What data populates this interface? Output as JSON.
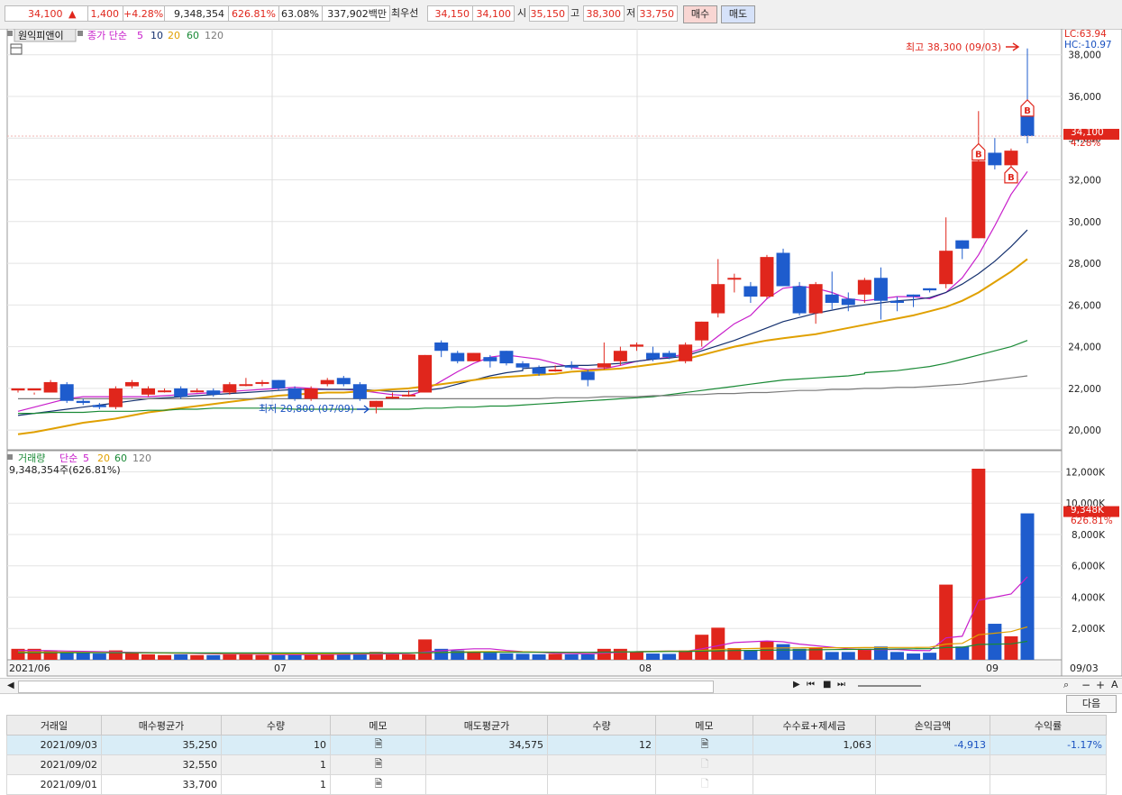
{
  "quote": {
    "price": "34,100",
    "arrow": "▲",
    "change": "1,400",
    "change_pct": "+4.28%",
    "volume": "9,348,354",
    "vol_ratio": "626.81%",
    "vol_turn": "63.08%",
    "amount": "337,902백만",
    "best_label": "최우선",
    "best_ask": "34,150",
    "best_bid": "34,100",
    "open_label": "시",
    "open": "35,150",
    "high_label": "고",
    "high": "38,300",
    "low_label": "저",
    "low": "33,750",
    "buy_label": "매수",
    "sell_label": "매도"
  },
  "chart_header": {
    "stock_name": "원익피앤이",
    "price_legend": "종가 단순",
    "ma_labels": [
      "5",
      "10",
      "20",
      "60",
      "120"
    ],
    "ma_colors": [
      "#c81ecb",
      "#14306e",
      "#e0a000",
      "#1a8a36",
      "#7a7a7a"
    ],
    "lc": "LC:63.94",
    "hc": "HC:-10.97",
    "vol_legend_label": "거래량",
    "vol_legend_type": "단순",
    "vol_ma_labels": [
      "5",
      "20",
      "60",
      "120"
    ],
    "vol_summary": "9,348,354주(626.81%)"
  },
  "annotations": {
    "max_label": "최고 38,300 (09/03)",
    "min_label": "최저 20,800 (07/09)",
    "last_price_tag": "34,100",
    "last_pct_tag": "4.28%",
    "last_vol_tag": "9,348K",
    "last_vol_pct_tag": "626.81%",
    "trade_marker": "B"
  },
  "chart_data": {
    "type": "candlestick",
    "x_labels": [
      "2021/06",
      "07",
      "08",
      "09",
      "09/03"
    ],
    "price_axis_ticks": [
      "20,000",
      "22,000",
      "24,000",
      "26,000",
      "28,000",
      "30,000",
      "32,000",
      "34,000",
      "36,000",
      "38,000"
    ],
    "price_ylim": [
      19000,
      39000
    ],
    "volume_axis_ticks": [
      "2,000K",
      "4,000K",
      "6,000K",
      "8,000K",
      "10,000K",
      "12,000K"
    ],
    "volume_ylim": [
      0,
      12500
    ],
    "candles": [
      [
        21900,
        22000,
        21800,
        21900
      ],
      [
        21900,
        22000,
        21800,
        21700
      ],
      [
        21800,
        22300,
        22400,
        22000
      ],
      [
        22200,
        21400,
        22300,
        21300
      ],
      [
        21400,
        21300,
        21500,
        21200
      ],
      [
        21200,
        21100,
        21300,
        21000
      ],
      [
        21100,
        22000,
        22100,
        21000
      ],
      [
        22100,
        22300,
        22400,
        22000
      ],
      [
        21700,
        22000,
        22100,
        21600
      ],
      [
        21900,
        21900,
        22000,
        21800
      ],
      [
        22000,
        21600,
        22100,
        21500
      ],
      [
        21900,
        21900,
        22000,
        21800
      ],
      [
        21900,
        21700,
        22000,
        21600
      ],
      [
        21800,
        22200,
        22300,
        21700
      ],
      [
        22200,
        22200,
        22500,
        22100
      ],
      [
        22300,
        22300,
        22400,
        22100
      ],
      [
        22400,
        22000,
        22400,
        21900
      ],
      [
        22000,
        21500,
        22100,
        21400
      ],
      [
        21500,
        22000,
        22100,
        21400
      ],
      [
        22200,
        22400,
        22500,
        22100
      ],
      [
        22500,
        22200,
        22600,
        22100
      ],
      [
        22200,
        21500,
        22300,
        21400
      ],
      [
        21100,
        21400,
        21400,
        20800
      ],
      [
        21600,
        21600,
        21800,
        21500
      ],
      [
        21700,
        21700,
        21900,
        21600
      ],
      [
        21800,
        23600,
        23600,
        21800
      ],
      [
        24200,
        23800,
        24300,
        23500
      ],
      [
        23700,
        23300,
        23800,
        23200
      ],
      [
        23300,
        23700,
        23700,
        23300
      ],
      [
        23500,
        23300,
        23600,
        23000
      ],
      [
        23800,
        23200,
        23800,
        23100
      ],
      [
        23200,
        23000,
        23300,
        22900
      ],
      [
        23000,
        22700,
        23100,
        22600
      ],
      [
        22900,
        22900,
        23100,
        22800
      ],
      [
        23100,
        23000,
        23300,
        22900
      ],
      [
        22800,
        22400,
        22900,
        22100
      ],
      [
        23000,
        23200,
        24200,
        22900
      ],
      [
        23300,
        23800,
        24000,
        23100
      ],
      [
        24000,
        24100,
        24200,
        23800
      ],
      [
        23700,
        23400,
        24000,
        23300
      ],
      [
        23700,
        23500,
        23800,
        23400
      ],
      [
        23300,
        24100,
        24200,
        23200
      ],
      [
        24300,
        25200,
        25200,
        24000
      ],
      [
        25600,
        27000,
        28200,
        25400
      ],
      [
        27300,
        27300,
        27500,
        26600
      ],
      [
        26900,
        26400,
        27100,
        26100
      ],
      [
        26400,
        28300,
        28400,
        26300
      ],
      [
        28500,
        26900,
        28700,
        26900
      ],
      [
        26900,
        25600,
        27100,
        25500
      ],
      [
        25600,
        27000,
        27100,
        25100
      ],
      [
        26500,
        26100,
        27600,
        25800
      ],
      [
        26300,
        26000,
        26600,
        25700
      ],
      [
        26500,
        27200,
        27300,
        26100
      ],
      [
        27300,
        26200,
        27800,
        25300
      ],
      [
        26200,
        26100,
        26400,
        25700
      ],
      [
        26500,
        26400,
        26500,
        25900
      ],
      [
        26800,
        26700,
        26800,
        26600
      ],
      [
        27000,
        28600,
        30200,
        26800
      ],
      [
        29100,
        28700,
        29100,
        28200
      ],
      [
        29200,
        32900,
        35300,
        29200
      ],
      [
        33300,
        32700,
        34000,
        32500
      ],
      [
        32700,
        33400,
        33500,
        32300
      ],
      [
        35150,
        34100,
        38300,
        33750
      ]
    ],
    "volumes": [
      700,
      700,
      600,
      500,
      450,
      400,
      600,
      450,
      350,
      300,
      350,
      300,
      300,
      400,
      350,
      300,
      300,
      350,
      350,
      400,
      350,
      400,
      500,
      350,
      350,
      1300,
      700,
      600,
      500,
      450,
      400,
      380,
      350,
      380,
      350,
      350,
      700,
      700,
      500,
      400,
      380,
      600,
      1600,
      2050,
      750,
      600,
      1200,
      1000,
      700,
      750,
      500,
      500,
      700,
      850,
      500,
      400,
      450,
      4800,
      850,
      12200,
      2300,
      1500,
      9348
    ],
    "moving_averages": [
      {
        "name": "5",
        "color": "#c81ecb",
        "values": [
          20900,
          21100,
          21300,
          21500,
          21600,
          21600,
          21600,
          21600,
          21600,
          21650,
          21700,
          21750,
          21800,
          21850,
          21900,
          21950,
          22000,
          22050,
          22000,
          21950,
          21950,
          21900,
          21800,
          21700,
          21650,
          21900,
          22350,
          22800,
          23200,
          23500,
          23600,
          23500,
          23400,
          23200,
          23000,
          22900,
          22950,
          23100,
          23300,
          23400,
          23500,
          23650,
          23900,
          24500,
          25100,
          25500,
          26300,
          26800,
          26900,
          26800,
          26600,
          26300,
          26200,
          26300,
          26400,
          26400,
          26300,
          26600,
          27300,
          28400,
          29800,
          31300,
          32400
        ]
      },
      {
        "name": "10",
        "color": "#14306e",
        "values": [
          20700,
          20800,
          20900,
          21000,
          21100,
          21200,
          21300,
          21400,
          21500,
          21550,
          21600,
          21650,
          21700,
          21750,
          21800,
          21850,
          21900,
          21950,
          21950,
          21950,
          21950,
          21950,
          21900,
          21850,
          21850,
          21900,
          22000,
          22200,
          22400,
          22600,
          22750,
          22850,
          22950,
          23000,
          23050,
          23100,
          23100,
          23150,
          23200,
          23300,
          23400,
          23450,
          23550,
          23800,
          24050,
          24300,
          24600,
          24900,
          25200,
          25400,
          25600,
          25750,
          25900,
          26000,
          26100,
          26200,
          26250,
          26350,
          26600,
          27000,
          27500,
          28100,
          28800,
          29600
        ]
      },
      {
        "name": "20",
        "color": "#e0a000",
        "values": [
          19800,
          19900,
          20050,
          20200,
          20350,
          20450,
          20550,
          20700,
          20850,
          20950,
          21050,
          21150,
          21250,
          21350,
          21450,
          21550,
          21650,
          21700,
          21750,
          21800,
          21800,
          21850,
          21900,
          21950,
          22000,
          22100,
          22200,
          22300,
          22400,
          22500,
          22550,
          22600,
          22650,
          22700,
          22800,
          22850,
          22900,
          22950,
          23050,
          23150,
          23250,
          23400,
          23600,
          23800,
          24000,
          24150,
          24300,
          24400,
          24500,
          24600,
          24750,
          24900,
          25050,
          25200,
          25350,
          25500,
          25700,
          25900,
          26200,
          26600,
          27100,
          27600,
          28200
        ]
      },
      {
        "name": "60",
        "color": "#1a8a36",
        "values": [
          20800,
          20800,
          20850,
          20850,
          20850,
          20900,
          20900,
          20900,
          20950,
          20950,
          21000,
          21000,
          21000,
          21050,
          21050,
          21050,
          21050,
          21050,
          21000,
          21000,
          21000,
          21000,
          21000,
          21000,
          21000,
          21000,
          21050,
          21050,
          21100,
          21100,
          21150,
          21150,
          21200,
          21200,
          21250,
          21300,
          21350,
          21400,
          21450,
          21500,
          21550,
          21600,
          21700,
          21800,
          21900,
          22000,
          22100,
          22200,
          22300,
          22400,
          22450,
          22500,
          22550,
          22600,
          22700,
          22750,
          22800,
          22850,
          22950,
          23050,
          23200,
          23400,
          23600,
          23800,
          24000,
          24300
        ]
      },
      {
        "name": "120",
        "color": "#7a7a7a",
        "values": [
          21500,
          21500,
          21500,
          21500,
          21500,
          21500,
          21500,
          21500,
          21500,
          21500,
          21500,
          21500,
          21500,
          21500,
          21500,
          21500,
          21500,
          21500,
          21500,
          21500,
          21500,
          21500,
          21500,
          21500,
          21500,
          21500,
          21500,
          21500,
          21500,
          21500,
          21500,
          21500,
          21500,
          21550,
          21550,
          21550,
          21600,
          21600,
          21600,
          21650,
          21650,
          21700,
          21700,
          21750,
          21750,
          21800,
          21800,
          21850,
          21900,
          21900,
          21950,
          21950,
          22000,
          22000,
          22050,
          22050,
          22100,
          22150,
          22200,
          22300,
          22400,
          22500,
          22600
        ]
      }
    ],
    "volume_ma": [
      {
        "name": "5",
        "color": "#c81ecb",
        "values": [
          600,
          600,
          580,
          560,
          540,
          520,
          500,
          480,
          460,
          440,
          420,
          400,
          380,
          370,
          360,
          350,
          340,
          330,
          330,
          340,
          350,
          360,
          370,
          380,
          390,
          500,
          580,
          650,
          700,
          700,
          600,
          520,
          480,
          420,
          400,
          380,
          420,
          480,
          520,
          540,
          560,
          540,
          700,
          900,
          1100,
          1150,
          1200,
          1150,
          1000,
          900,
          800,
          700,
          650,
          650,
          650,
          600,
          580,
          1400,
          1500,
          3800,
          4000,
          4200,
          5300
        ]
      },
      {
        "name": "20",
        "color": "#e0a000",
        "values": [
          500,
          500,
          500,
          490,
          480,
          470,
          460,
          450,
          440,
          430,
          420,
          420,
          410,
          400,
          400,
          390,
          380,
          380,
          380,
          380,
          390,
          400,
          410,
          420,
          420,
          450,
          480,
          500,
          520,
          530,
          520,
          510,
          500,
          490,
          480,
          470,
          480,
          500,
          520,
          540,
          560,
          560,
          600,
          650,
          700,
          720,
          740,
          760,
          760,
          770,
          770,
          770,
          780,
          780,
          790,
          790,
          800,
          1000,
          1050,
          1600,
          1700,
          1800,
          2100
        ]
      },
      {
        "name": "60",
        "color": "#1a8a36",
        "values": [
          450,
          450,
          450,
          450,
          450,
          450,
          450,
          450,
          450,
          450,
          450,
          440,
          440,
          440,
          440,
          440,
          440,
          440,
          440,
          440,
          440,
          440,
          440,
          440,
          440,
          450,
          460,
          470,
          480,
          480,
          480,
          480,
          480,
          480,
          480,
          480,
          490,
          500,
          510,
          520,
          530,
          530,
          550,
          570,
          590,
          600,
          610,
          620,
          630,
          640,
          650,
          660,
          670,
          680,
          690,
          700,
          710,
          780,
          800,
          980,
          1000,
          1020,
          1180
        ]
      }
    ]
  },
  "toolbar_icons": [
    "prev-icon",
    "rewind-icon",
    "stop-icon",
    "forward-icon",
    "zoom-icon",
    "plus-icon",
    "minus-icon"
  ],
  "table": {
    "next_label": "다음",
    "headers": [
      "거래일",
      "매수평균가",
      "수량",
      "메모",
      "매도평균가",
      "수량",
      "메모",
      "수수료+제세금",
      "손익금액",
      "수익률"
    ],
    "rows": [
      [
        "2021/09/03",
        "35,250",
        "10",
        "",
        "34,575",
        "12",
        "",
        "1,063",
        "-4,913",
        "-1.17%"
      ],
      [
        "2021/09/02",
        "32,550",
        "1",
        "",
        "",
        "",
        "",
        "",
        "",
        ""
      ],
      [
        "2021/09/01",
        "33,700",
        "1",
        "",
        "",
        "",
        "",
        "",
        "",
        ""
      ]
    ]
  }
}
